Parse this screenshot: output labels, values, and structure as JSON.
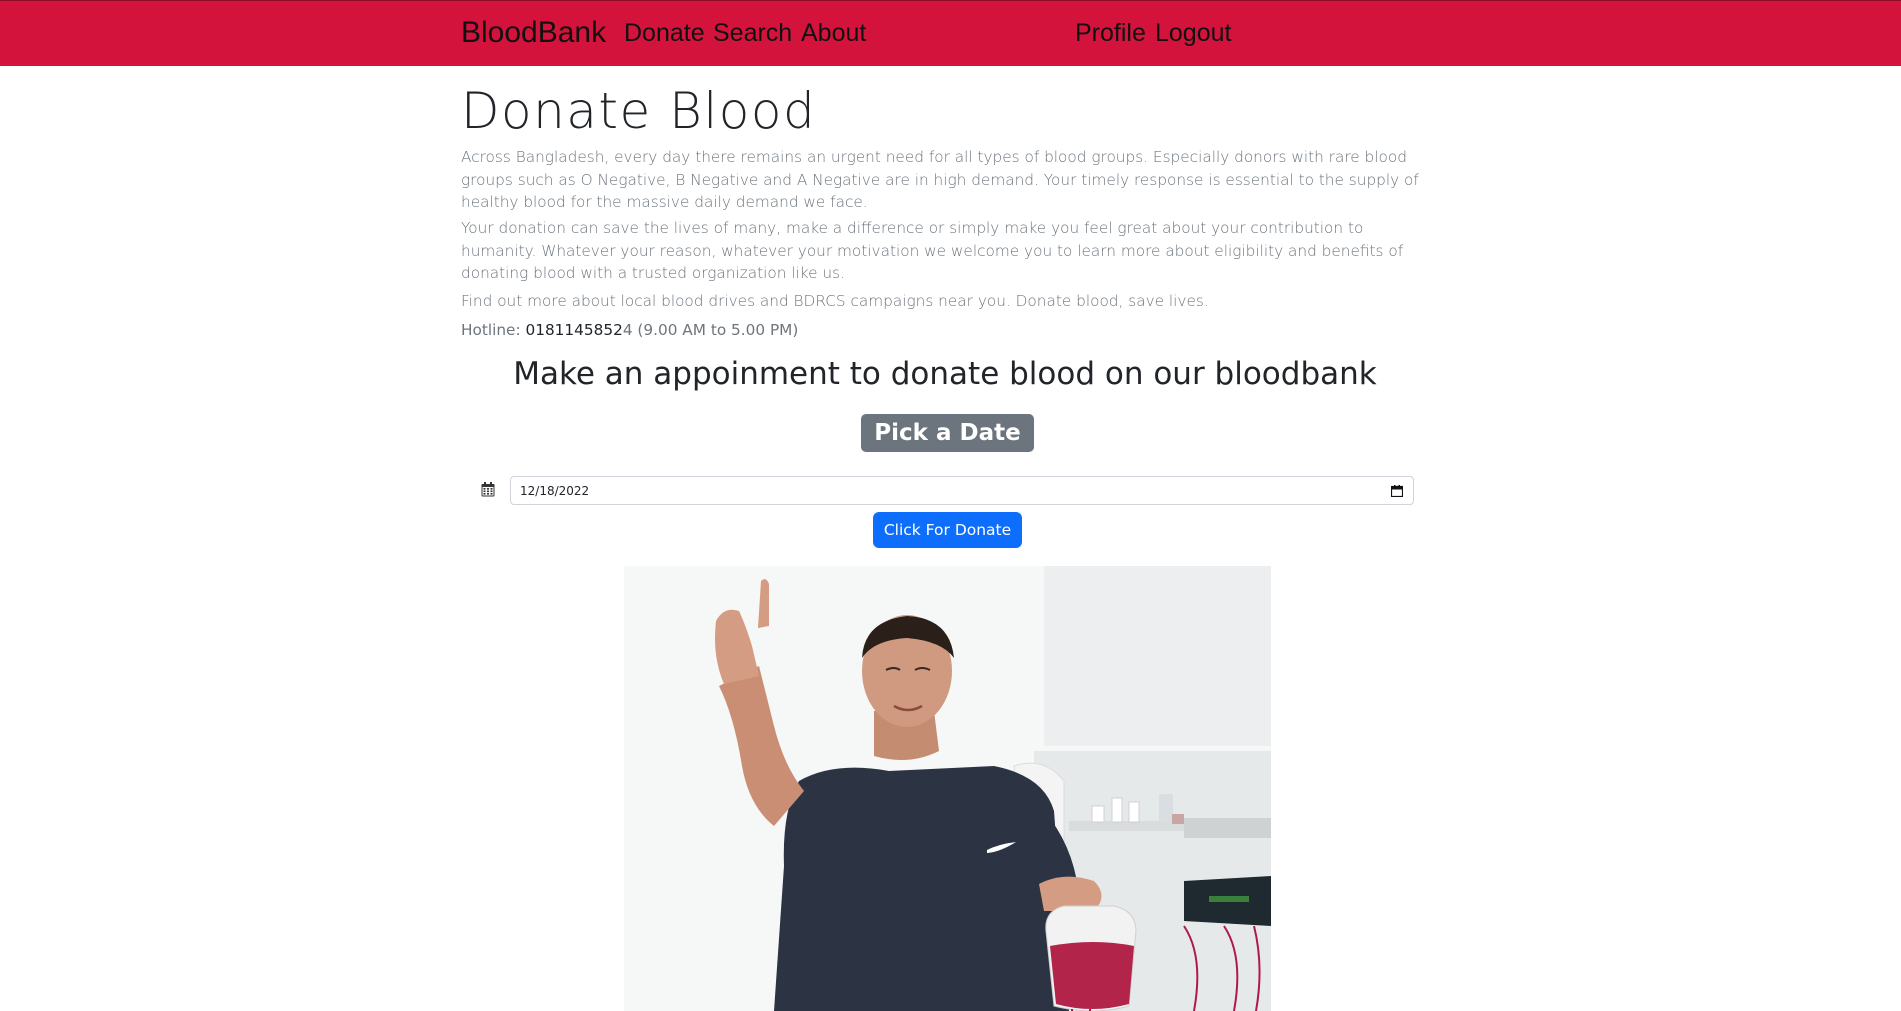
{
  "navbar": {
    "brand": "BloodBank",
    "links": [
      "Donate",
      "Search",
      "About"
    ],
    "right_links": [
      "Profile",
      "Logout"
    ],
    "background_color": "#d3133c"
  },
  "main": {
    "title": "Donate Blood",
    "paragraphs": [
      "Across Bangladesh, every day there remains an urgent need for all types of blood groups. Especially donors with rare blood groups such as O Negative, B Negative and A Negative are in high demand. Your timely response is essential to the supply of healthy blood for the massive daily demand we face.",
      "Your donation can save the lives of many, make a difference or simply make you feel great about your contribution to humanity. Whatever your reason, whatever your motivation we welcome you to learn more about eligibility and benefits of donating blood with a trusted organization like us.",
      "Find out more about local blood drives and BDRCS campaigns near you. Donate blood, save lives."
    ],
    "hotline": {
      "label": "Hotline: ",
      "number": "0181145852",
      "suffix": "4 (9.00 AM to 5.00 PM)"
    }
  },
  "appointment": {
    "heading": "Make an appoinment to donate blood on our bloodbank",
    "badge": "Pick a Date",
    "date_value": "12/18/2022",
    "submit_label": "Click For Donate"
  },
  "icons": {
    "calendar": "calendar-icon",
    "date_picker": "date-picker-icon"
  },
  "colors": {
    "accent": "#d3133c",
    "primary_button": "#0d6efd",
    "badge": "#6c757d"
  }
}
